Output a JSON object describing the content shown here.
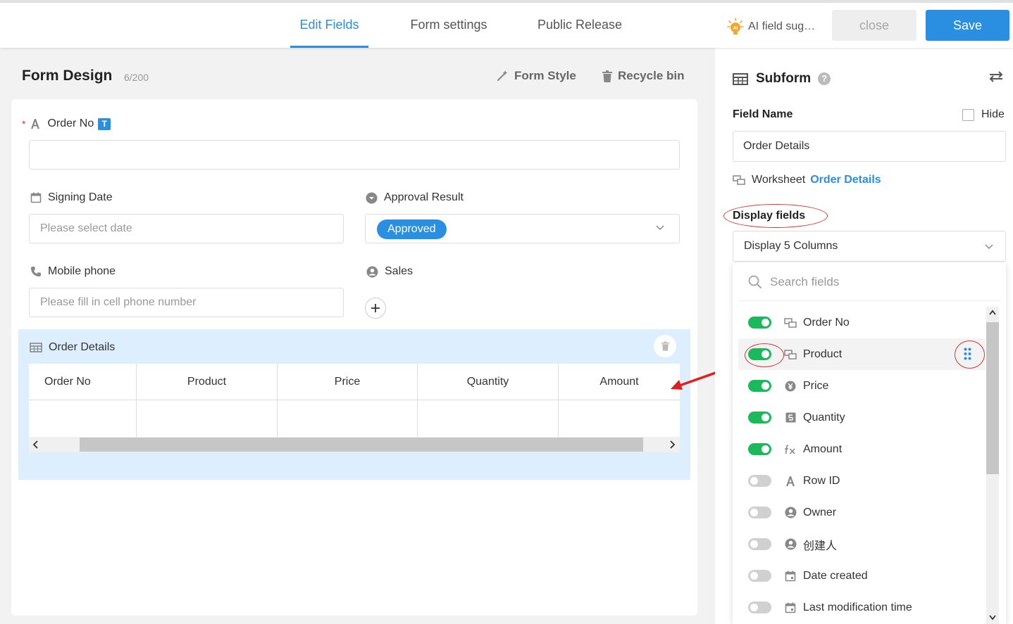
{
  "topbar": {
    "tabs": [
      {
        "label": "Edit Fields",
        "active": true
      },
      {
        "label": "Form settings",
        "active": false
      },
      {
        "label": "Public Release",
        "active": false
      }
    ],
    "ai_suggestion": "AI field sug…",
    "ai_badge": "AI",
    "close_label": "close",
    "save_label": "Save"
  },
  "form_design": {
    "title": "Form Design",
    "count": "6/200",
    "form_style": "Form Style",
    "recycle_bin": "Recycle bin"
  },
  "form": {
    "order_no": {
      "label": "Order No",
      "required_mark": "*",
      "badge": "T"
    },
    "signing_date": {
      "label": "Signing Date",
      "placeholder": "Please select date"
    },
    "approval_result": {
      "label": "Approval Result",
      "value": "Approved"
    },
    "mobile_phone": {
      "label": "Mobile phone",
      "placeholder": "Please fill in cell phone number"
    },
    "sales": {
      "label": "Sales"
    },
    "subform": {
      "title": "Order Details",
      "columns": [
        "Order No",
        "Product",
        "Price",
        "Quantity",
        "Amount"
      ]
    }
  },
  "panel": {
    "title": "Subform",
    "help": "?",
    "field_name_label": "Field Name",
    "hide_label": "Hide",
    "field_name_value": "Order Details",
    "worksheet_label": "Worksheet",
    "worksheet_link": "Order Details",
    "display_fields_label": "Display fields",
    "display_select": "Display 5 Columns",
    "search_placeholder": "Search fields",
    "fields": [
      {
        "label": "Order No",
        "on": true,
        "icon": "link-icon"
      },
      {
        "label": "Product",
        "on": true,
        "icon": "link-icon"
      },
      {
        "label": "Price",
        "on": true,
        "icon": "yen-icon"
      },
      {
        "label": "Quantity",
        "on": true,
        "icon": "number-icon"
      },
      {
        "label": "Amount",
        "on": true,
        "icon": "formula-icon"
      },
      {
        "label": "Row ID",
        "on": false,
        "icon": "text-icon"
      },
      {
        "label": "Owner",
        "on": false,
        "icon": "user-icon"
      },
      {
        "label": "创建人",
        "on": false,
        "icon": "user-icon"
      },
      {
        "label": "Date created",
        "on": false,
        "icon": "calendar-icon"
      },
      {
        "label": "Last modification time",
        "on": false,
        "icon": "calendar-icon"
      }
    ]
  },
  "colors": {
    "accent": "#2a8fe0",
    "toggle_on": "#19b95c",
    "annotation_red": "#d93636"
  }
}
